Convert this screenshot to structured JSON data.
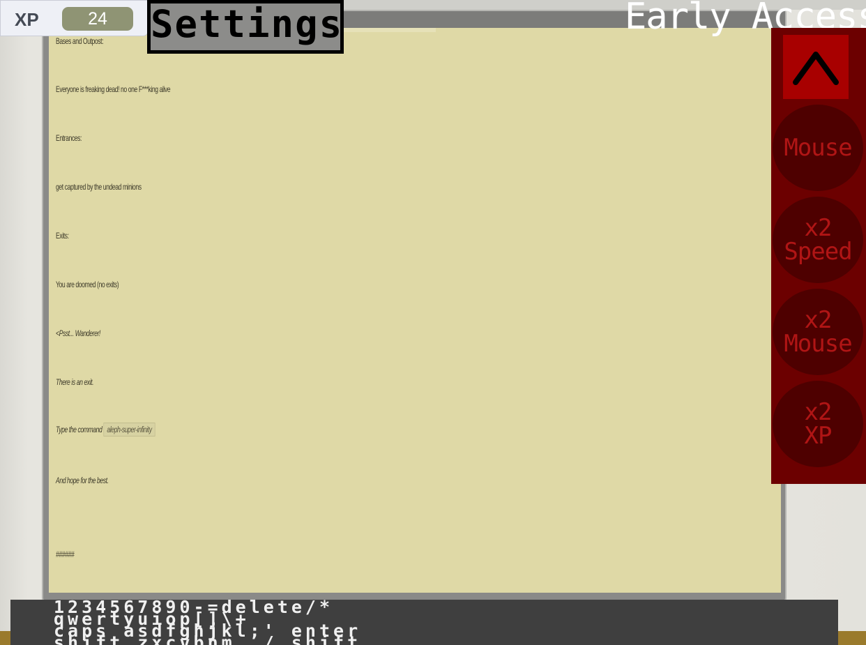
{
  "header": {
    "xp_label": "XP",
    "xp_value": "24",
    "settings_label": "Settings",
    "title": "Early Access"
  },
  "document": {
    "lines": [
      "Bases and Outpost:",
      "Everyone is freaking dead! no one F***king alive",
      "Entrances:",
      "get captured by the undead minions",
      "Exits:",
      "You are doomed (no exits)",
      "<Psst... Wanderer!",
      "There is an exit.",
      "Type the command",
      "And hope for the best.",
      "######"
    ],
    "command": "aleph-super-infinity"
  },
  "side_panel": {
    "collapse_icon": "caret-up-icon",
    "buttons": [
      {
        "line1": "Mouse",
        "line2": ""
      },
      {
        "line1": "x2",
        "line2": "Speed"
      },
      {
        "line1": "x2",
        "line2": "Mouse"
      },
      {
        "line1": "x2",
        "line2": "XP"
      }
    ]
  },
  "keyboard": {
    "rows": [
      "1234567890-=delete/*",
      "qwertyuiop[]\\+",
      "caps asdfghjkl;' enter",
      "shift zxcvbnm,./ shift"
    ]
  },
  "colors": {
    "paper": "#dfd9a6",
    "side_panel": "#6c0000",
    "side_button_text": "#b01515",
    "keyboard_bg": "#3f3f3f"
  }
}
